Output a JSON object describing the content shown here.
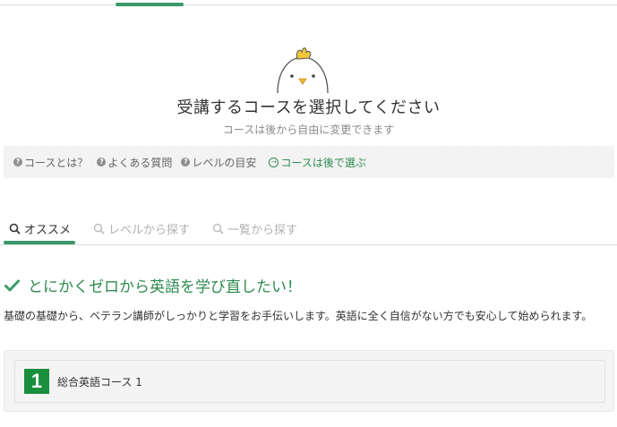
{
  "header": {
    "title": "受講するコースを選択してください",
    "subtitle": "コースは後から自由に変更できます"
  },
  "help_links": [
    {
      "label": "コースとは？",
      "icon": "question-circle-icon"
    },
    {
      "label": "よくある質問",
      "icon": "question-circle-icon"
    },
    {
      "label": "レベルの目安",
      "icon": "question-circle-icon"
    }
  ],
  "later_link": {
    "label": "コースは後で選ぶ",
    "icon": "arrow-circle-icon"
  },
  "tabs": [
    {
      "label": "オススメ",
      "active": true,
      "icon": "search-icon"
    },
    {
      "label": "レベルから探す",
      "active": false,
      "icon": "search-icon"
    },
    {
      "label": "一覧から探す",
      "active": false,
      "icon": "search-icon"
    }
  ],
  "recommendation": {
    "heading": "とにかくゼロから英語を学び直したい！",
    "description": "基礎の基礎から、ベテラン講師がしっかりと学習をお手伝いします。英語に全く自信がない方でも安心して始められます。",
    "course": {
      "number": "1",
      "name": "総合英語コース 1"
    }
  },
  "colors": {
    "accent": "#3a9a68",
    "brand_green": "#1a8f3e",
    "link_green": "#2e8b4f"
  }
}
